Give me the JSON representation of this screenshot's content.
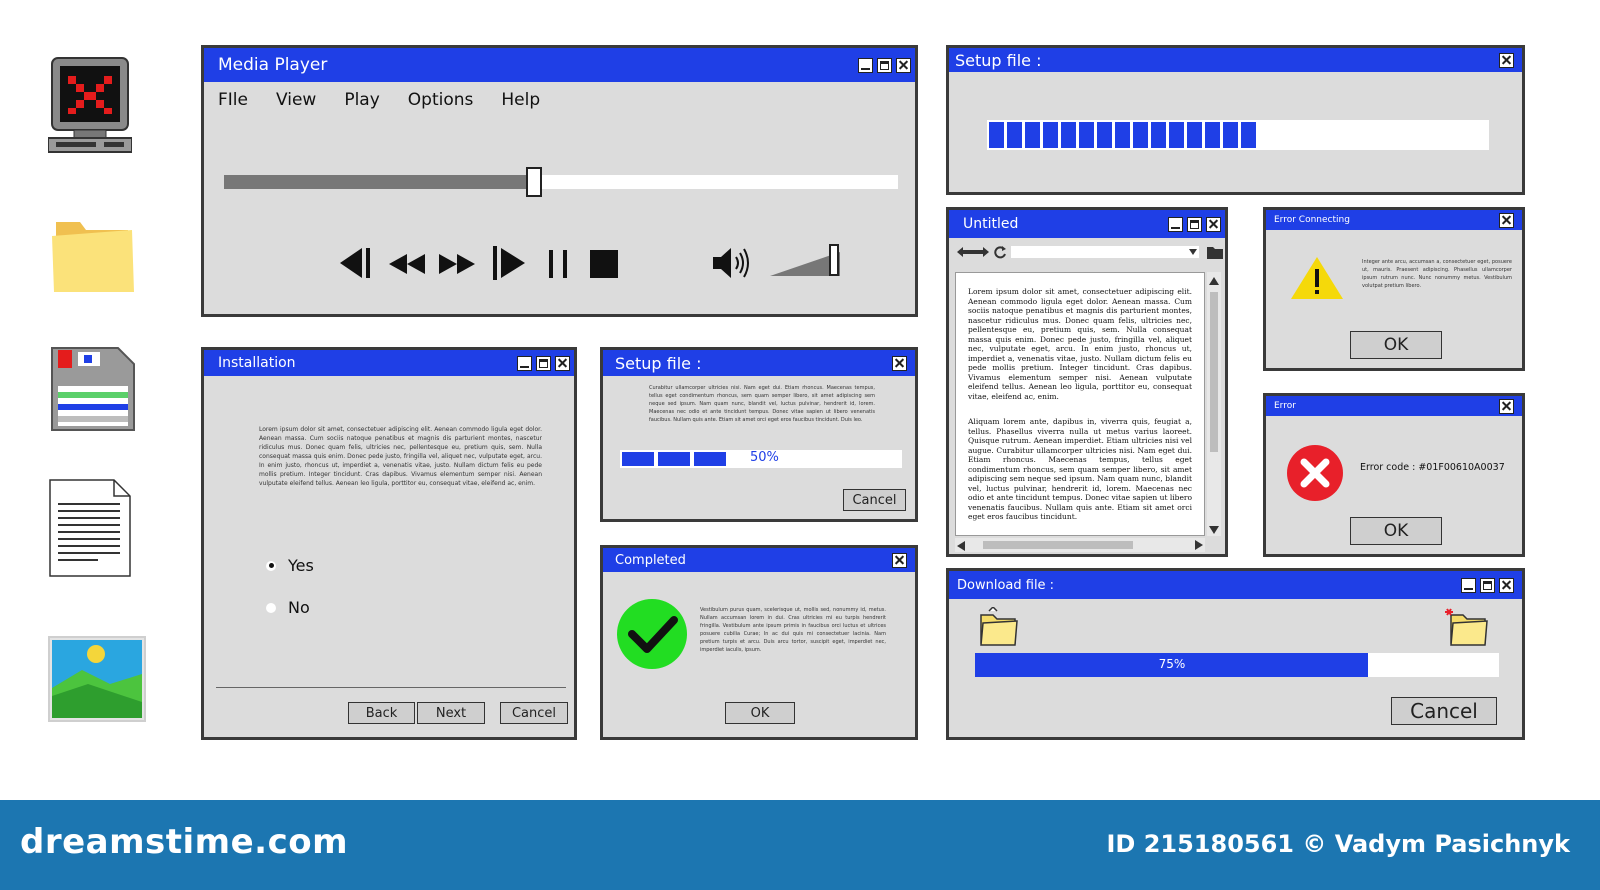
{
  "desktop_icons": [
    "computer-error-icon",
    "folder-icon",
    "floppy-disk-icon",
    "text-document-icon",
    "image-icon"
  ],
  "media_player": {
    "title": "Media Player",
    "menu": [
      "FIle",
      "View",
      "Play",
      "Options",
      "Help"
    ],
    "seek_progress": 0.46,
    "volume_level": 0.9,
    "controls": [
      "skip-previous-icon",
      "rewind-icon",
      "fast-forward-icon",
      "play-icon",
      "pause-icon",
      "stop-icon",
      "speaker-icon"
    ]
  },
  "setup_top": {
    "title": "Setup file :",
    "progress": 0.55,
    "progress_style": "segmented"
  },
  "installation": {
    "title": "Installation",
    "body": "Lorem ipsum dolor sit amet, consectetuer adipiscing elit. Aenean commodo ligula eget dolor. Aenean massa. Cum sociis natoque penatibus et magnis dis parturient montes, nascetur ridiculus mus. Donec quam felis, ultricies nec, pellentesque eu, pretium quis, sem. Nulla consequat massa quis enim. Donec pede justo, fringilla vel, aliquet nec, vulputate eget, arcu. In enim justo, rhoncus ut, imperdiet a, venenatis vitae, justo. Nullam dictum felis eu pede mollis pretium. Integer tincidunt. Cras dapibus. Vivamus elementum semper nisi. Aenean vulputate eleifend tellus. Aenean leo ligula, porttitor eu, consequat vitae, eleifend ac, enim.",
    "options": [
      "Yes",
      "No"
    ],
    "selected": "Yes",
    "back_label": "Back",
    "next_label": "Next",
    "cancel_label": "Cancel"
  },
  "setup_mid": {
    "title": "Setup file :",
    "body": "Curabitur ullamcorper ultricies nisi. Nam eget dui. Etiam rhoncus. Maecenas tempus, tellus eget condimentum rhoncus, sem quam semper libero, sit amet adipiscing sem neque sed ipsum. Nam quam nunc, blandit vel, luctus pulvinar, hendrerit id, lorem. Maecenas nec odio et ante tincidunt tempus. Donec vitae sapien ut libero venenatis faucibus. Nullam quis ante. Etiam sit amet orci eget eros faucibus tincidunt. Duis leo.",
    "progress": 0.5,
    "progress_label": "50%",
    "cancel_label": "Cancel"
  },
  "completed": {
    "title": "Completed",
    "body": "Vestibulum purus quam, scelerisque ut, mollis sed, nonummy id, metus. Nullam accumsan lorem in dui. Cras ultricies mi eu turpis hendrerit fringilla. Vestibulum ante ipsum primis in faucibus orci luctus et ultrices posuere cubilia Curae; In ac dui quis mi consectetuer lacinia. Nam pretium turpis et arcu. Duis arcu tortor, suscipit eget, imperdiet nec, imperdiet iaculis, ipsum.",
    "ok_label": "OK"
  },
  "editor": {
    "title": "Untitled",
    "para1": "Lorem ipsum dolor sit amet, consectetuer adipiscing elit. Aenean commodo ligula eget dolor. Aenean massa. Cum sociis natoque penatibus et magnis dis parturient montes, nascetur ridiculus mus. Donec quam felis, ultricies nec, pellentesque eu, pretium quis, sem. Nulla consequat massa quis enim. Donec pede justo, fringilla vel, aliquet nec, vulputate eget, arcu. In enim justo, rhoncus ut, imperdiet a, venenatis vitae, justo. Nullam dictum felis eu pede mollis pretium. Integer tincidunt. Cras dapibus. Vivamus elementum semper nisi. Aenean vulputate eleifend tellus. Aenean leo ligula, porttitor eu, consequat vitae, eleifend ac, enim.",
    "para2": "Aliquam lorem ante, dapibus in, viverra quis, feugiat a, tellus. Phasellus viverra nulla ut metus varius laoreet. Quisque rutrum. Aenean imperdiet. Etiam ultricies nisi vel augue. Curabitur ullamcorper ultricies nisi. Nam eget dui. Etiam rhoncus. Maecenas tempus, tellus eget condimentum rhoncus, sem quam semper libero, sit amet adipiscing sem neque sed ipsum. Nam quam nunc, blandit vel, luctus pulvinar, hendrerit id, lorem. Maecenas nec odio et ante tincidunt tempus. Donec vitae sapien ut libero venenatis faucibus. Nullam quis ante. Etiam sit amet orci eget eros faucibus tincidunt."
  },
  "error_connecting": {
    "title": "Error Connecting",
    "body": "Integer ante arcu, accumsan a, consectetuer eget, posuere ut, mauris. Praesent adipiscing. Phasellus ullamcorper ipsum rutrum nunc. Nunc nonummy metus. Vestibulum volutpat pretium libero.",
    "ok_label": "OK"
  },
  "error": {
    "title": "Error",
    "message": "Error code : #01F00610A0037",
    "ok_label": "OK"
  },
  "download": {
    "title": "Download file :",
    "progress": 0.75,
    "progress_label": "75%",
    "cancel_label": "Cancel"
  },
  "colors": {
    "accent": "#1f3fe6",
    "window_bg": "#dcdcdc",
    "footer_bg": "#1c76b1",
    "success": "#22dd22",
    "error": "#e8202a",
    "warning": "#f5d90a"
  },
  "footer": {
    "brand": "dreamstime.com",
    "credit": "ID 215180561 © Vadym Pasichnyk"
  }
}
